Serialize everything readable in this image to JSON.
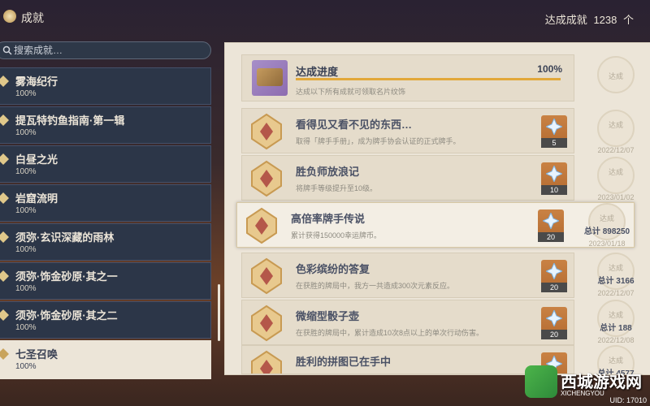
{
  "header": {
    "title": "成就",
    "total_label": "达成成就",
    "total_count": "1238",
    "total_unit": "个"
  },
  "search": {
    "placeholder": "搜索成就…"
  },
  "categories": [
    {
      "name": "雾海纪行",
      "percent": "100%"
    },
    {
      "name": "提瓦特钓鱼指南·第一辑",
      "percent": "100%"
    },
    {
      "name": "白昼之光",
      "percent": "100%"
    },
    {
      "name": "岩窟流明",
      "percent": "100%"
    },
    {
      "name": "须弥·玄识深藏的雨林",
      "percent": "100%"
    },
    {
      "name": "须弥·饰金砂原·其之一",
      "percent": "100%"
    },
    {
      "name": "须弥·饰金砂原·其之二",
      "percent": "100%"
    },
    {
      "name": "七圣召唤",
      "percent": "100%"
    }
  ],
  "progress": {
    "title": "达成进度",
    "percent": "100%",
    "fill": 1.0,
    "description": "达成以下所有成就可领取名片纹饰",
    "stamp": "达成"
  },
  "achievements": [
    {
      "title": "看得见又看不见的东西…",
      "description": "取得「牌手手册」，成为牌手协会认证的正式牌手。",
      "reward": "5",
      "stamp": "达成",
      "total": "",
      "date": "2022/12/07"
    },
    {
      "title": "胜负师放浪记",
      "description": "将牌手等级提升至10级。",
      "reward": "10",
      "stamp": "达成",
      "total": "",
      "date": "2023/01/02"
    },
    {
      "title": "高倍率牌手传说",
      "description": "累计获得150000幸运牌币。",
      "reward": "20",
      "stamp": "达成",
      "total": "总计 898250",
      "date": "2023/01/18"
    },
    {
      "title": "色彩缤纷的答复",
      "description": "在获胜的牌局中，我方一共造成300次元素反应。",
      "reward": "20",
      "stamp": "达成",
      "total": "总计 3166",
      "date": "2022/12/07"
    },
    {
      "title": "微缩型骰子壶",
      "description": "在获胜的牌局中，累计造成10次8点以上的单次行动伤害。",
      "reward": "20",
      "stamp": "达成",
      "total": "总计 188",
      "date": "2022/12/08"
    },
    {
      "title": "胜利的拼图已在手中",
      "description": "",
      "reward": "20",
      "stamp": "达成",
      "total": "总计 4577",
      "date": ""
    }
  ],
  "watermark": {
    "title": "西城游戏网",
    "sub": "XICHENGYOU",
    "uid": "UID: 17010"
  },
  "colors": {
    "accent": "#e2a83a",
    "panel": "#ece5d8",
    "category_bg": "#2c3648"
  }
}
